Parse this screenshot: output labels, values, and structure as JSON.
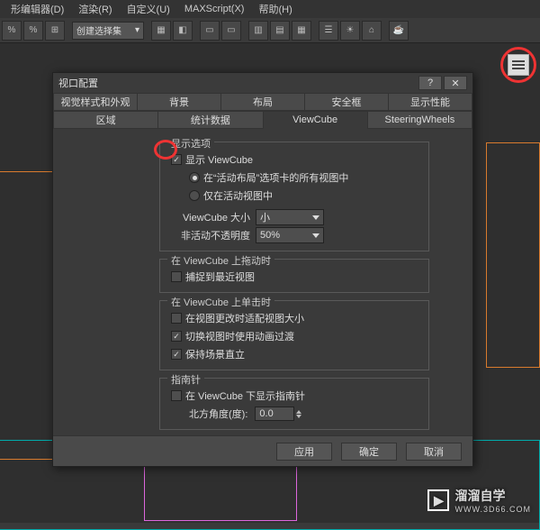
{
  "menubar": [
    "形编辑器(D)",
    "渲染(R)",
    "自定义(U)",
    "MAXScript(X)",
    "帮助(H)"
  ],
  "toolCombo": "创建选择集",
  "dialog": {
    "title": "视口配置",
    "helpGlyph": "?",
    "closeGlyph": "✕",
    "tabsRow1": [
      "视觉样式和外观",
      "背景",
      "布局",
      "安全框",
      "显示性能"
    ],
    "tabsRow2": [
      "区域",
      "统计数据",
      "ViewCube",
      "SteeringWheels"
    ],
    "groups": {
      "display": {
        "title": "显示选项",
        "showViewCube": "显示 ViewCube",
        "radio1": "在“活动布局”选项卡的所有视图中",
        "radio2": "仅在活动视图中",
        "sizeLabel": "ViewCube 大小",
        "sizeValue": "小",
        "opacityLabel": "非活动不透明度",
        "opacityValue": "50%"
      },
      "drag": {
        "title": "在 ViewCube 上拖动时",
        "snap": "捕捉到最近视图"
      },
      "click": {
        "title": "在 ViewCube 上单击时",
        "fit": "在视图更改时适配视图大小",
        "anim": "切换视图时使用动画过渡",
        "up": "保持场景直立"
      },
      "compass": {
        "title": "指南针",
        "show": "在 ViewCube 下显示指南针",
        "northLabel": "北方角度(度):",
        "northValue": "0.0"
      }
    },
    "buttons": {
      "apply": "应用",
      "ok": "确定",
      "cancel": "取消"
    }
  },
  "watermark": {
    "text": "溜溜自学",
    "url": "WWW.3D66.COM"
  }
}
